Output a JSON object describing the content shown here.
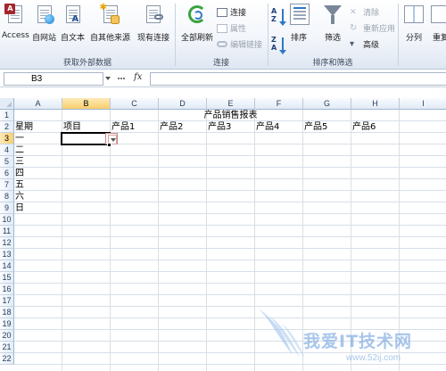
{
  "ribbon": {
    "get_external_data": {
      "group_label": "获取外部数据",
      "access": "Access",
      "web": "自网站",
      "text": "自文本",
      "other_sources": "自其他来源",
      "existing_connections": "现有连接"
    },
    "connections": {
      "group_label": "连接",
      "refresh_all": "全部刷新",
      "connections": "连接",
      "properties": "属性",
      "edit_links": "编辑链接"
    },
    "sort_filter": {
      "group_label": "排序和筛选",
      "sort": "排序",
      "filter": "筛选",
      "clear": "清除",
      "reapply": "重新应用",
      "advanced": "高级"
    },
    "data_tools": {
      "text_to_columns": "分列",
      "remove_duplicates_partial": "重复"
    }
  },
  "formula_bar": {
    "name_box": "B3",
    "fx": "fx",
    "formula": ""
  },
  "grid": {
    "columns": [
      "A",
      "B",
      "C",
      "D",
      "E",
      "F",
      "G",
      "H",
      "I"
    ],
    "rows": [
      "1",
      "2",
      "3",
      "4",
      "5",
      "6",
      "7",
      "8",
      "9",
      "10",
      "11",
      "12",
      "13",
      "14",
      "15",
      "16",
      "17",
      "18",
      "19",
      "20",
      "21",
      "22"
    ],
    "selected_column": "B",
    "selected_row": "3",
    "title": "产品销售报表",
    "headers": [
      "星期",
      "项目",
      "产品1",
      "产品2",
      "产品3",
      "产品4",
      "产品5",
      "产品6"
    ],
    "weekdays": [
      "一",
      "二",
      "三",
      "四",
      "五",
      "六",
      "日"
    ]
  },
  "watermark": {
    "brand": "我爱IT技术网",
    "url": "www.52ij.com"
  },
  "colors": {
    "ribbon_bg": "#f3f6fb",
    "header_bg": "#e4ecf7",
    "selected_header": "#f8cf6e",
    "gridline": "#d8dfe8"
  }
}
